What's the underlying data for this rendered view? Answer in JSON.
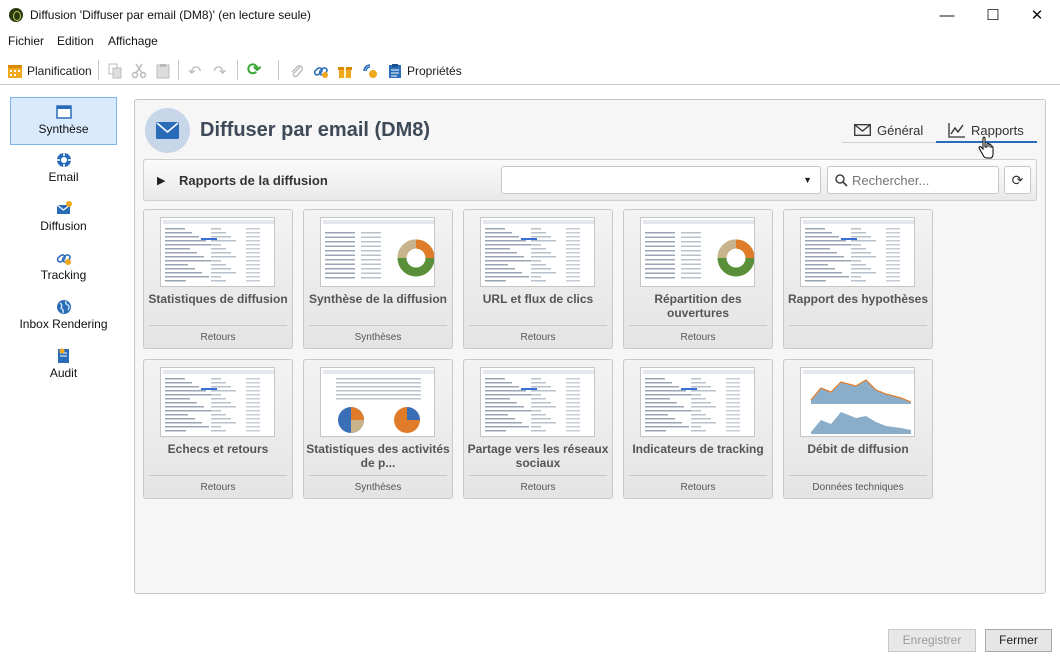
{
  "window": {
    "title": "Diffusion 'Diffuser par email (DM8)' (en lecture seule)"
  },
  "menu": [
    "Fichier",
    "Edition",
    "Affichage"
  ],
  "toolbar": {
    "planification_label": "Planification",
    "properties_label": "Propriétés"
  },
  "sidebar": {
    "items": [
      {
        "label": "Synthèse",
        "icon": "synthese-icon",
        "active": true
      },
      {
        "label": "Email",
        "icon": "email-icon"
      },
      {
        "label": "Diffusion",
        "icon": "diffusion-icon"
      },
      {
        "label": "Tracking",
        "icon": "tracking-icon"
      },
      {
        "label": "Inbox Rendering",
        "icon": "globe-icon"
      },
      {
        "label": "Audit",
        "icon": "audit-icon"
      }
    ]
  },
  "header": {
    "title": "Diffuser par email (DM8)"
  },
  "tabs": [
    {
      "label": "Général",
      "icon": "envelope-icon",
      "active": false
    },
    {
      "label": "Rapports",
      "icon": "chart-line-icon",
      "active": true
    }
  ],
  "section": {
    "title": "Rapports de la diffusion",
    "select_value": "",
    "search_placeholder": "Rechercher..."
  },
  "reports": [
    {
      "title": "Statistiques de diffusion",
      "category": "Retours",
      "thumb": "table"
    },
    {
      "title": "Synthèse de la diffusion",
      "category": "Synthèses",
      "thumb": "donut"
    },
    {
      "title": "URL et flux de clics",
      "category": "Retours",
      "thumb": "table"
    },
    {
      "title": "Répartition des ouvertures",
      "category": "Retours",
      "thumb": "donut"
    },
    {
      "title": "Rapport des hypothèses",
      "category": "",
      "thumb": "table"
    },
    {
      "title": "Echecs et retours",
      "category": "Retours",
      "thumb": "table"
    },
    {
      "title": "Statistiques des activités de p...",
      "category": "Synthèses",
      "thumb": "pies"
    },
    {
      "title": "Partage vers les réseaux sociaux",
      "category": "Retours",
      "thumb": "table"
    },
    {
      "title": "Indicateurs de tracking",
      "category": "Retours",
      "thumb": "table"
    },
    {
      "title": "Débit de diffusion",
      "category": "Données techniques",
      "thumb": "area"
    }
  ],
  "footer": {
    "save_label": "Enregistrer",
    "close_label": "Fermer"
  },
  "colors": {
    "accent": "#2b6cb8",
    "sidebar_active": "#d8eafc"
  }
}
